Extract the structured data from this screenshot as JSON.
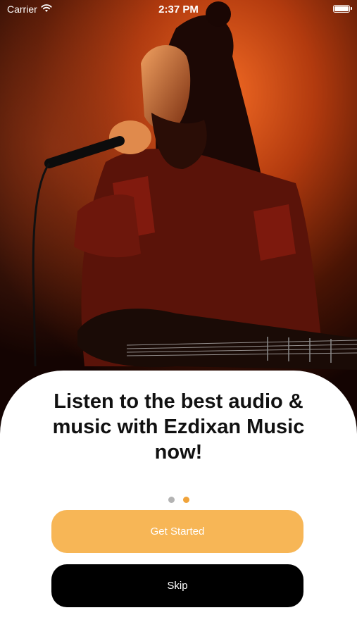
{
  "status_bar": {
    "carrier": "Carrier",
    "time": "2:37 PM",
    "icons": [
      "wifi-icon",
      "battery-icon"
    ]
  },
  "hero": {
    "image": "singer-with-microphone-and-guitar-on-stage-photo"
  },
  "onboarding": {
    "headline": "Listen to the best audio & music with Ezdixan Music now!",
    "page_count": 2,
    "active_page": 2,
    "get_started_label": "Get Started",
    "skip_label": "Skip"
  },
  "colors": {
    "accent": "#f7b656",
    "active_dot": "#f0a33a",
    "inactive_dot": "#b3b3b3",
    "skip_bg": "#000000",
    "sheet_bg": "#ffffff"
  }
}
